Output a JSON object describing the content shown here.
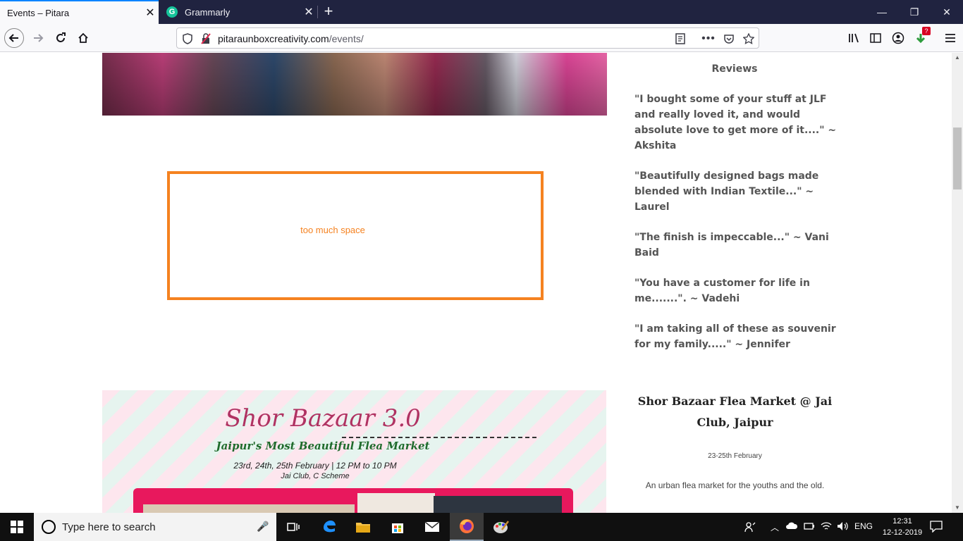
{
  "browser": {
    "tabs": [
      {
        "title": "Events – Pitara",
        "active": true
      },
      {
        "title": "Grammarly",
        "active": false,
        "badge": "G"
      }
    ],
    "url": {
      "domain": "pitaraunboxcreativity.com",
      "path": "/events/"
    },
    "extension_badge": "?"
  },
  "annotation": {
    "text": "too much space",
    "color": "#f58220"
  },
  "reviews": {
    "heading": "Reviews",
    "items": [
      "\"I bought some of your stuff at JLF and really loved it, and would absolute love to get more of it....\"                ~ Akshita",
      "\"Beautifully designed bags made blended with Indian Textile...\"     ~ Laurel",
      "\"The finish is impeccable...\"     ~ Vani Baid",
      "\"You have a customer for life in me.......\".      ~ Vadehi",
      "\"I am taking all of these as souvenir for my family.....\"     ~ Jennifer"
    ]
  },
  "poster": {
    "title": "Shor Bazaar 3.0",
    "subtitle": "Jaipur's Most Beautiful Flea Market",
    "dates": "23rd, 24th, 25th February | 12 PM to 10 PM",
    "venue": "Jai Club, C Scheme"
  },
  "event": {
    "title": "Shor Bazaar Flea Market @ Jai Club, Jaipur",
    "date": "23-25th February",
    "description": "An urban flea market for the youths and the old."
  },
  "taskbar": {
    "search_placeholder": "Type here to search",
    "language": "ENG",
    "time": "12:31",
    "date": "12-12-2019"
  }
}
